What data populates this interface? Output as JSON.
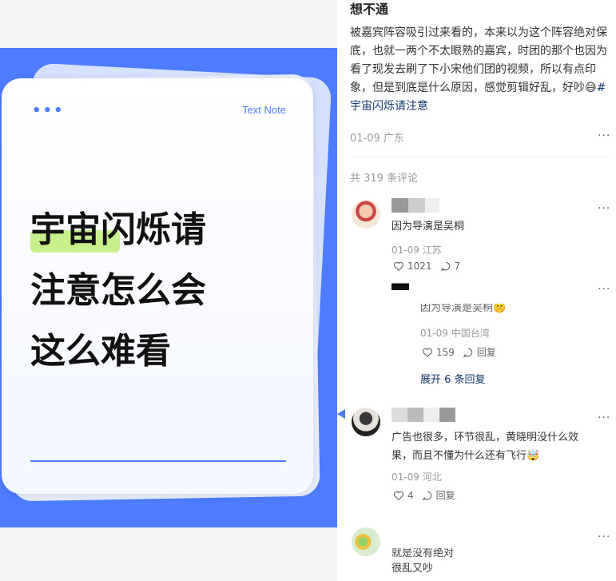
{
  "image_card": {
    "dots": "•••",
    "tag": "Text Note",
    "headline_lines": [
      "宇宙闪烁请",
      "注意怎么会",
      "这么难看"
    ]
  },
  "post": {
    "title": "想不通",
    "body": "被嘉宾阵容吸引过来看的，本来以为这个阵容绝对保底，也就一两个不太眼熟的嘉宾，时团的那个也因为看了现发去刷了下小宋他们团的视频，所以有点印象，但是到底是什么原因，感觉剪辑好乱，好吵",
    "emoji": "😅",
    "hashtag": "#宇宙闪烁请注意",
    "date": "01-09",
    "location": "广东",
    "more": "···"
  },
  "comments_header": "共 319 条评论",
  "comments": [
    {
      "text": "因为导演是吴桐",
      "date": "01-09",
      "location": "江苏",
      "likes": "1021",
      "replies": "7",
      "more": "···"
    },
    {
      "is_reply": true,
      "text": "因为导演是吴桐",
      "emoji": "🤫",
      "date": "01-09",
      "location": "中国台湾",
      "likes": "159",
      "reply_label": "回复",
      "more": "···"
    },
    {
      "text": "广告也很多，环节很乱，黄晓明没什么效果，而且不懂为什么还有飞行",
      "emoji": "🤯",
      "date": "01-09",
      "location": "河北",
      "likes": "4",
      "reply_label": "回复",
      "more": "···"
    },
    {
      "text": "就是没有绝对",
      "text2": "很乱又吵",
      "more": "···"
    }
  ],
  "expand_replies": "展开 6 条回复",
  "colors": {
    "accent": "#4d7cff",
    "link": "#13386c",
    "highlight": "#c7f08d"
  }
}
